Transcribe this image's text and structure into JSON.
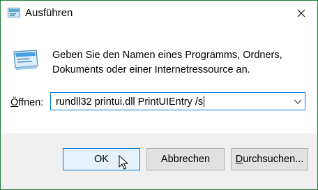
{
  "window": {
    "title": "Ausführen"
  },
  "dialog": {
    "description": "Geben Sie den Namen eines Programms, Ordners, Dokuments oder einer Internetressource an.",
    "open_label_prefix": "Ö",
    "open_label_rest": "ffnen:",
    "open_value": "rundll32 printui.dll PrintUIEntry /s"
  },
  "buttons": {
    "ok": "OK",
    "cancel": "Abbrechen",
    "browse_prefix": "D",
    "browse_rest": "urchsuchen..."
  },
  "icons": {
    "title": "run-icon",
    "main": "run-icon",
    "close": "close-icon",
    "dropdown": "chevron-down-icon",
    "cursor": "mouse-pointer-icon"
  },
  "colors": {
    "border": "#1e7d3a",
    "focus": "#0078d7",
    "footer": "#f0f0f0"
  }
}
